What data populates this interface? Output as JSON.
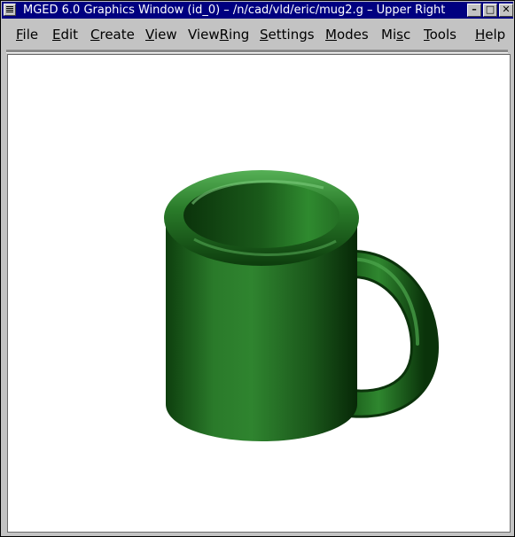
{
  "window": {
    "title": "MGED 6.0 Graphics Window (id_0) – /n/cad/vld/eric/mug2.g – Upper Right",
    "buttons": {
      "minimize": "–",
      "maximize": "□",
      "close": "✕"
    }
  },
  "menu": {
    "items": [
      {
        "pre": "",
        "mnemonic": "F",
        "post": "ile"
      },
      {
        "pre": "",
        "mnemonic": "E",
        "post": "dit"
      },
      {
        "pre": "",
        "mnemonic": "C",
        "post": "reate"
      },
      {
        "pre": "",
        "mnemonic": "V",
        "post": "iew"
      },
      {
        "pre": "View",
        "mnemonic": "R",
        "post": "ing"
      },
      {
        "pre": "",
        "mnemonic": "S",
        "post": "ettings"
      },
      {
        "pre": "",
        "mnemonic": "M",
        "post": "odes"
      },
      {
        "pre": "Mi",
        "mnemonic": "s",
        "post": "c"
      },
      {
        "pre": "",
        "mnemonic": "T",
        "post": "ools"
      },
      {
        "pre": "",
        "mnemonic": "H",
        "post": "elp"
      }
    ]
  },
  "viewport": {
    "object_icon": "mug-icon",
    "mug_color": "#1f6a1f",
    "background": "#ffffff"
  }
}
